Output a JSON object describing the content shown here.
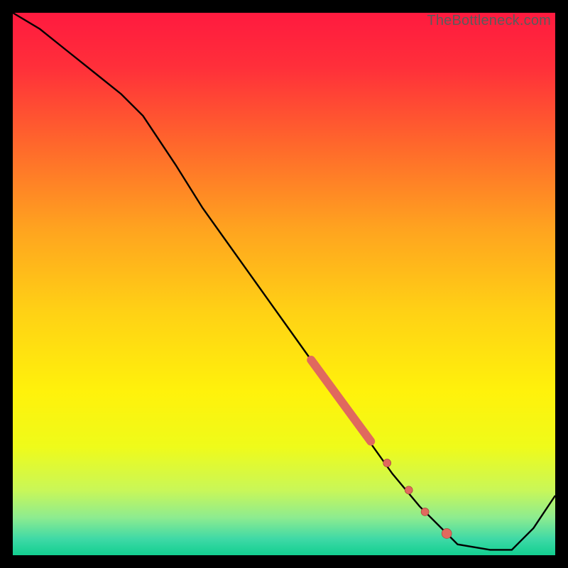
{
  "watermark": "TheBottleneck.com",
  "gradient_stops": [
    {
      "offset": 0.0,
      "color": "#ff1a3f"
    },
    {
      "offset": 0.1,
      "color": "#ff2f3a"
    },
    {
      "offset": 0.25,
      "color": "#ff6a2b"
    },
    {
      "offset": 0.4,
      "color": "#ffa41f"
    },
    {
      "offset": 0.55,
      "color": "#ffd115"
    },
    {
      "offset": 0.7,
      "color": "#fff20b"
    },
    {
      "offset": 0.8,
      "color": "#effb1a"
    },
    {
      "offset": 0.88,
      "color": "#c9f758"
    },
    {
      "offset": 0.93,
      "color": "#8eec8f"
    },
    {
      "offset": 0.97,
      "color": "#3fd9a6"
    },
    {
      "offset": 1.0,
      "color": "#12cf90"
    }
  ],
  "curve_color": "#000000",
  "curve_width": 2.4,
  "marker_color": "#e0695e",
  "marker_stroke": "#a03e36",
  "chart_data": {
    "type": "line",
    "title": "",
    "xlabel": "",
    "ylabel": "",
    "xlim": [
      0,
      100
    ],
    "ylim": [
      0,
      100
    ],
    "grid": false,
    "legend": false,
    "series": [
      {
        "name": "bottleneck-curve",
        "style": "line",
        "x": [
          0,
          5,
          10,
          15,
          20,
          24,
          30,
          35,
          40,
          45,
          50,
          55,
          60,
          65,
          70,
          75,
          80,
          82,
          88,
          92,
          96,
          100
        ],
        "y": [
          100,
          97,
          93,
          89,
          85,
          81,
          72,
          64,
          57,
          50,
          43,
          36,
          29,
          22,
          15,
          9,
          4,
          2,
          1,
          1,
          5,
          11
        ]
      },
      {
        "name": "highlight-segment",
        "style": "thick-line",
        "x": [
          55,
          66
        ],
        "y": [
          36,
          21
        ]
      },
      {
        "name": "highlight-points",
        "style": "points",
        "x": [
          69,
          73,
          76,
          80
        ],
        "y": [
          17,
          12,
          8,
          4
        ]
      }
    ]
  }
}
